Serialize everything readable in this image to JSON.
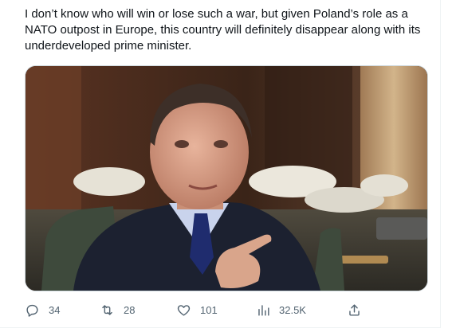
{
  "tweet": {
    "text": "I don’t know who will win or lose such a war, but given Poland’s role as a NATO outpost in Europe, this country will definitely disappear along with its underdeveloped prime minister."
  },
  "media": {
    "alt": "Man in dark suit and blue tie pointing at the camera, telephones in the background"
  },
  "actions": {
    "replies": "34",
    "retweets": "28",
    "likes": "101",
    "views": "32.5K"
  },
  "icons": {
    "reply": "reply-icon",
    "retweet": "retweet-icon",
    "like": "heart-icon",
    "views": "views-icon",
    "share": "share-icon"
  },
  "colors": {
    "text": "#0f1419",
    "muted": "#536471",
    "border": "#cfd9de"
  }
}
